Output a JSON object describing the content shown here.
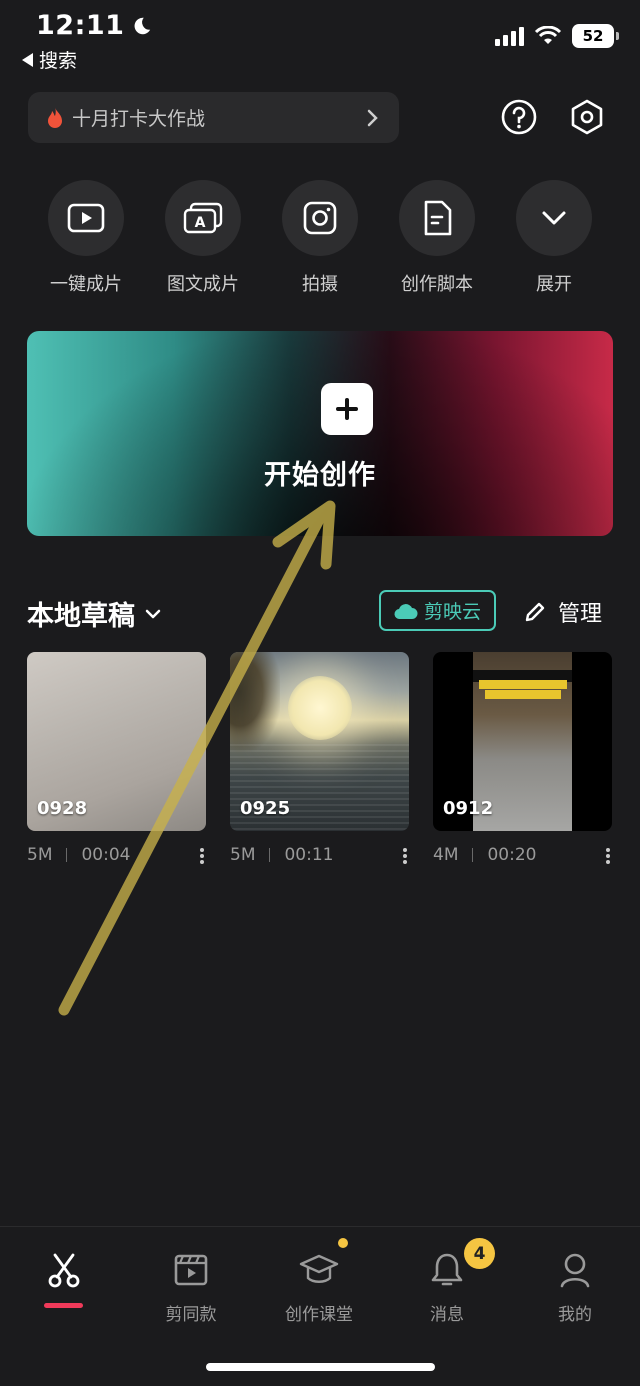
{
  "status_bar": {
    "time": "12:11",
    "back_label": "搜索",
    "battery": "52"
  },
  "header": {
    "promo_text": "十月打卡大作战",
    "help_icon": "question-circle-icon",
    "settings_icon": "hexagon-settings-icon"
  },
  "quick_actions": [
    {
      "label": "一键成片",
      "icon": "play-square-icon"
    },
    {
      "label": "图文成片",
      "icon": "text-to-video-icon"
    },
    {
      "label": "拍摄",
      "icon": "camera-icon"
    },
    {
      "label": "创作脚本",
      "icon": "script-doc-icon"
    },
    {
      "label": "展开",
      "icon": "chevron-down-icon"
    }
  ],
  "create": {
    "label": "开始创作"
  },
  "drafts": {
    "title": "本地草稿",
    "cloud_label": "剪映云",
    "manage_label": "管理",
    "items": [
      {
        "date": "0928",
        "size": "5M",
        "duration": "00:04"
      },
      {
        "date": "0925",
        "size": "5M",
        "duration": "00:11"
      },
      {
        "date": "0912",
        "size": "4M",
        "duration": "00:20"
      }
    ]
  },
  "tabbar": {
    "items": [
      {
        "label": "",
        "icon": "scissors-icon",
        "active": true
      },
      {
        "label": "剪同款",
        "icon": "clapperboard-icon"
      },
      {
        "label": "创作课堂",
        "icon": "graduation-cap-icon"
      },
      {
        "label": "消息",
        "icon": "bell-icon"
      },
      {
        "label": "我的",
        "icon": "user-icon"
      }
    ],
    "message_badge": "4"
  },
  "colors": {
    "accent_teal": "#4bcbb7",
    "active_underline": "#f03a5a",
    "badge_yellow": "#f5c542",
    "annotation_arrow": "#c9b24a"
  }
}
